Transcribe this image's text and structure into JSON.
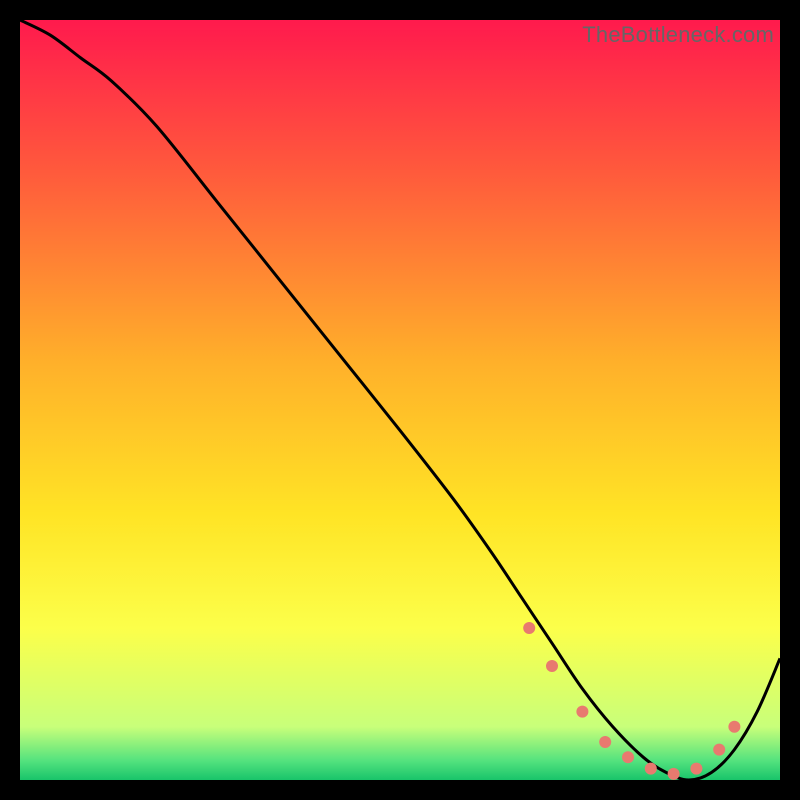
{
  "watermark": "TheBottleneck.com",
  "chart_data": {
    "type": "line",
    "title": "",
    "xlabel": "",
    "ylabel": "",
    "xlim": [
      0,
      100
    ],
    "ylim": [
      0,
      100
    ],
    "grid": false,
    "legend": false,
    "background_gradient": {
      "stops": [
        {
          "pos": 0.0,
          "color": "#ff1a4d"
        },
        {
          "pos": 0.2,
          "color": "#ff5a3c"
        },
        {
          "pos": 0.45,
          "color": "#ffb02a"
        },
        {
          "pos": 0.65,
          "color": "#ffe425"
        },
        {
          "pos": 0.8,
          "color": "#fcff4a"
        },
        {
          "pos": 0.93,
          "color": "#c8ff7a"
        },
        {
          "pos": 0.975,
          "color": "#53e27e"
        },
        {
          "pos": 1.0,
          "color": "#18c46a"
        }
      ]
    },
    "series": [
      {
        "name": "curve",
        "color": "#000000",
        "x": [
          0,
          4,
          8,
          12,
          18,
          26,
          34,
          42,
          50,
          57,
          62,
          66,
          70,
          74,
          78,
          82,
          85,
          88,
          91,
          94,
          97,
          100
        ],
        "y": [
          100,
          98,
          95,
          92,
          86,
          76,
          66,
          56,
          46,
          37,
          30,
          24,
          18,
          12,
          7,
          3,
          1,
          0,
          1,
          4,
          9,
          16
        ]
      }
    ],
    "markers": {
      "color": "#e87a6f",
      "radius": 6,
      "points": [
        {
          "x": 67,
          "y": 20
        },
        {
          "x": 70,
          "y": 15
        },
        {
          "x": 74,
          "y": 9
        },
        {
          "x": 77,
          "y": 5
        },
        {
          "x": 80,
          "y": 3
        },
        {
          "x": 83,
          "y": 1.5
        },
        {
          "x": 86,
          "y": 0.8
        },
        {
          "x": 89,
          "y": 1.5
        },
        {
          "x": 92,
          "y": 4
        },
        {
          "x": 94,
          "y": 7
        }
      ]
    }
  }
}
